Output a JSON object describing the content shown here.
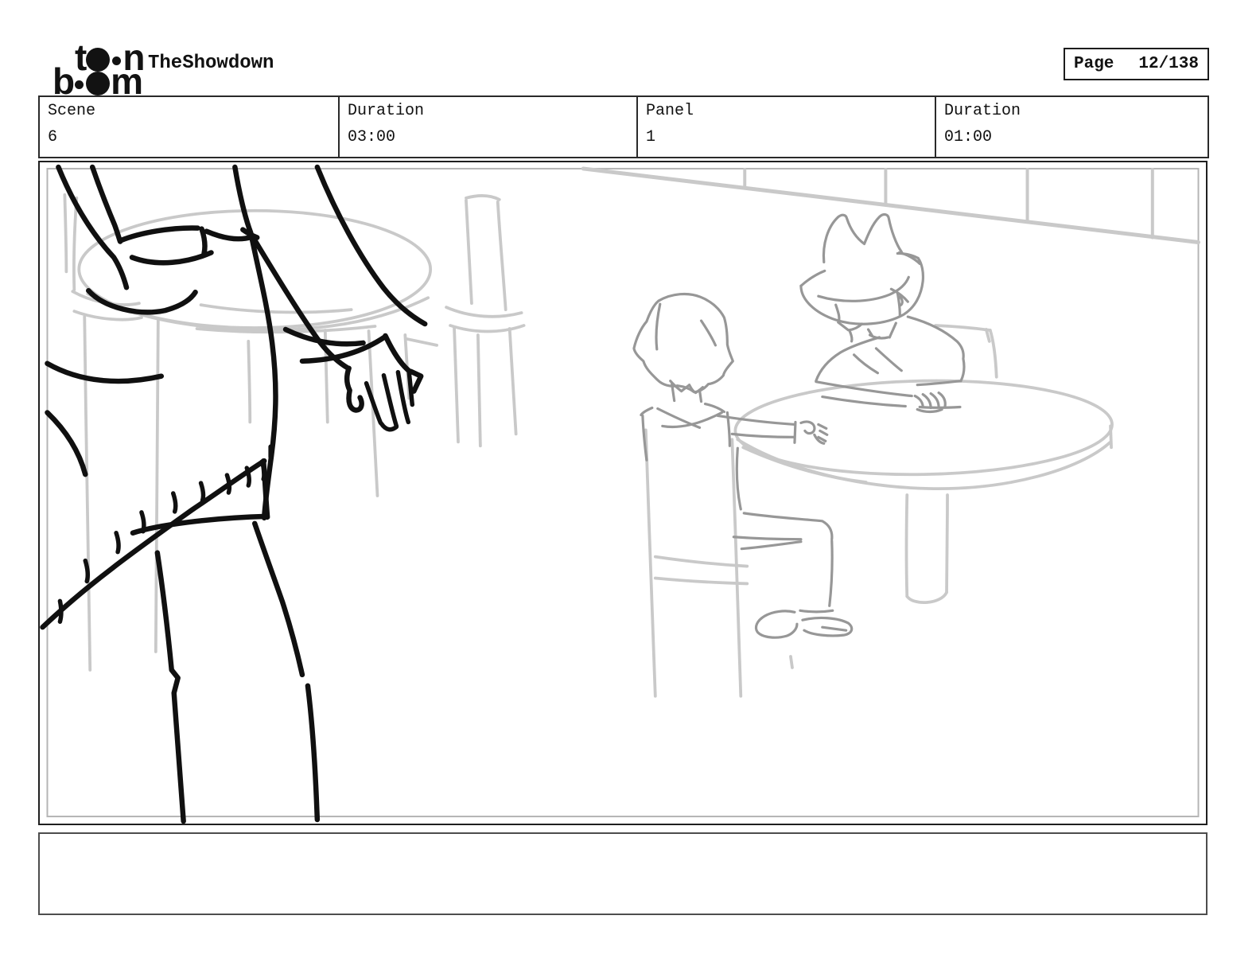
{
  "header": {
    "logo": {
      "line1_letter_left": "t",
      "line1_letter_right": "n",
      "line2_letter_left": "b",
      "line2_letter_right": "m"
    },
    "title": "TheShowdown",
    "page_label": "Page",
    "page_value": "12/138"
  },
  "info_row": {
    "cells": [
      {
        "label": "Scene",
        "value": "6"
      },
      {
        "label": "Duration",
        "value": "03:00"
      },
      {
        "label": "Panel",
        "value": "1"
      },
      {
        "label": "Duration",
        "value": "01:00"
      }
    ]
  },
  "panel_content": {
    "description": "storyboard sketch: foreground figure standing with hanging hand and fringed jacket; background round table with boy seated opposite a cowboy-hatted man; second table with chairs at left",
    "caption_text": ""
  },
  "colors": {
    "foreground_ink": "#101010",
    "character_ink": "#979797",
    "background_ink": "#c9c9c9",
    "frame_border": "#1f1f1f",
    "inner_frame": "#b5b5b5",
    "caption_border": "#4d4d4d"
  }
}
